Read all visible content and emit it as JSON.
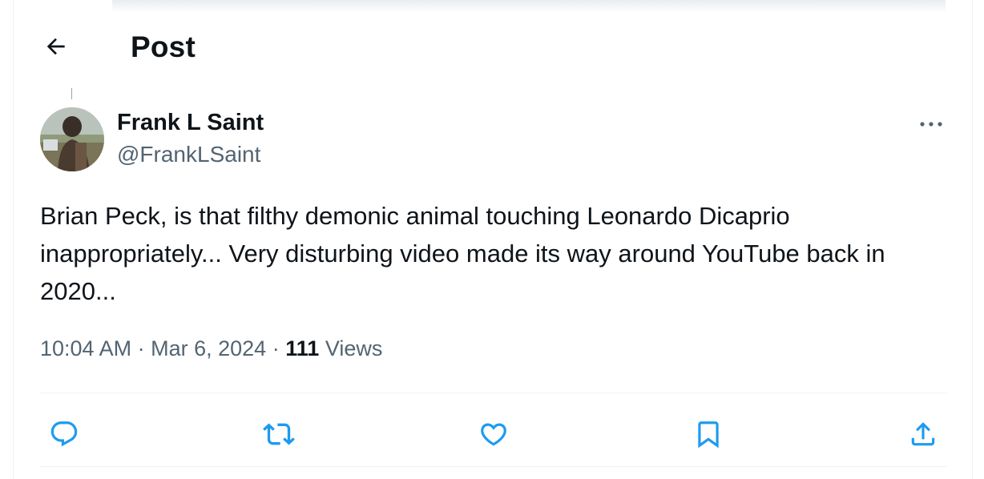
{
  "header": {
    "title": "Post",
    "back_icon": "arrow-left-icon"
  },
  "post": {
    "author": {
      "name": "Frank L Saint",
      "handle": "@FrankLSaint"
    },
    "text": "Brian Peck, is that filthy demonic animal  touching Leonardo Dicaprio inappropriately... Very disturbing video made its way around YouTube back in 2020...",
    "time": "10:04 AM",
    "date": "Mar 6, 2024",
    "views_count": "111",
    "views_label": "Views",
    "separator": "·"
  },
  "actions": [
    "reply-icon",
    "repost-icon",
    "like-icon",
    "bookmark-icon",
    "share-icon"
  ],
  "colors": {
    "text": "#0f1419",
    "secondary": "#536471",
    "action_icon": "#1d9bf0",
    "divider": "#eff3f4"
  }
}
